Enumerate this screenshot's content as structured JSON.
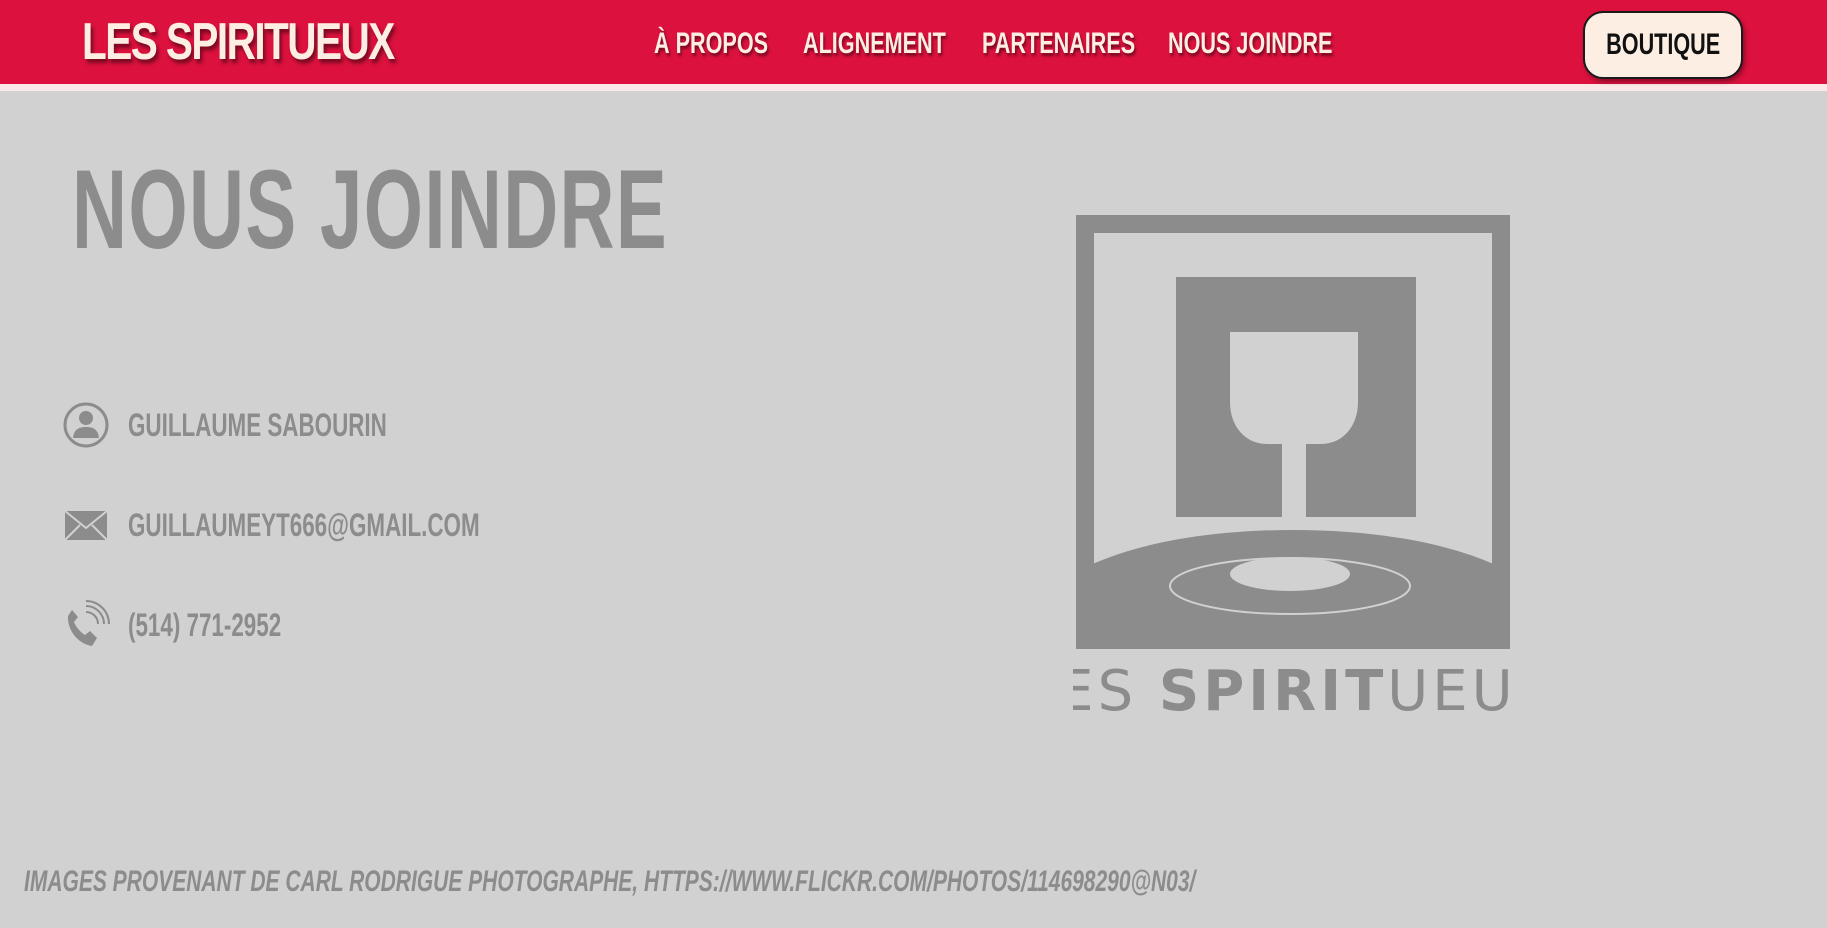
{
  "header": {
    "brand": "LES SPIRITUEUX",
    "nav": [
      "À PROPOS",
      "ALIGNEMENT",
      "PARTENAIRES",
      "NOUS JOINDRE"
    ],
    "shop_label": "BOUTIQUE"
  },
  "main": {
    "title": "NOUS JOINDRE",
    "contact": {
      "name": "GUILLAUME SABOURIN",
      "email": "GUILLAUMEYT666@GMAIL.COM",
      "phone": "(514) 771-2952"
    },
    "logo": {
      "text_light_1": "LES ",
      "text_bold": "SPIRIT",
      "text_light_2": "UEUX"
    }
  },
  "footer": {
    "credits": "IMAGES PROVENANT DE CARL RODRIGUE PHOTOGRAPHE, HTTPS://WWW.FLICKR.COM/PHOTOS/114698290@N03/"
  },
  "colors": {
    "header_red": "#dc113d",
    "header_text": "#fdeee4",
    "page_bg": "#d1d1d1",
    "muted_gray": "#8c8c8c"
  },
  "icons": [
    "user-circle-icon",
    "envelope-icon",
    "phone-icon",
    "wine-glass-logo"
  ]
}
